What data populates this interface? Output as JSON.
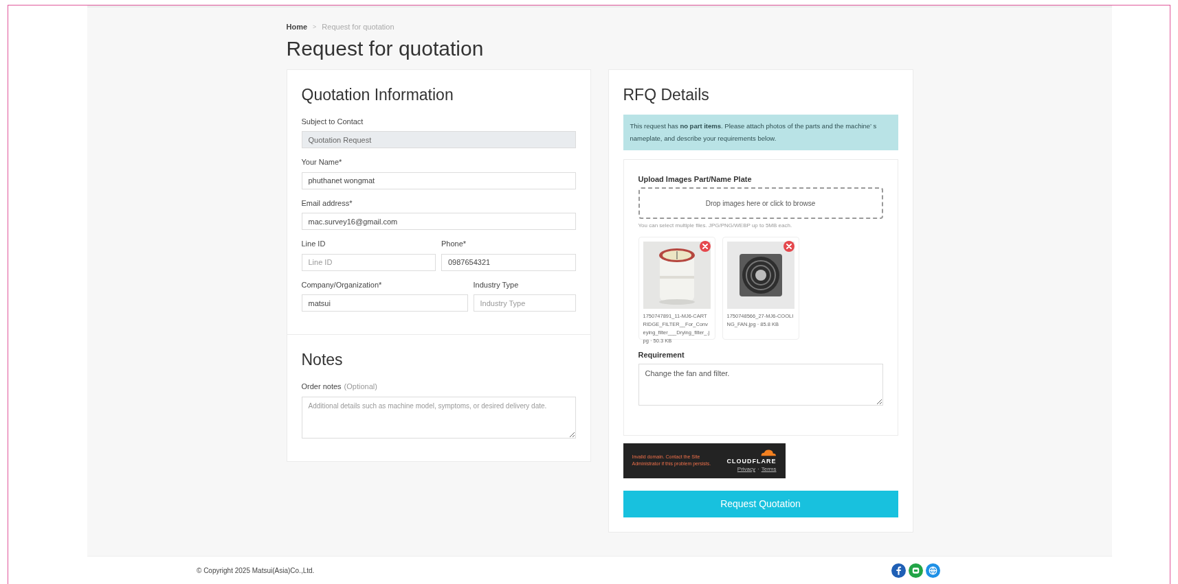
{
  "breadcrumb": {
    "items": [
      {
        "label": "Home",
        "current": false
      },
      {
        "label": "Request for quotation",
        "current": true
      }
    ],
    "separator": ">"
  },
  "title": "Request for quotation",
  "quotation_information": {
    "title": "Quotation Information",
    "rows": [
      {
        "kind": "single",
        "fields": [
          {
            "label": "Subject to Contact",
            "value": "Quotation Request",
            "disabled": true
          }
        ]
      },
      {
        "kind": "single",
        "fields": [
          {
            "label": "Your Name*",
            "value": "phuthanet wongmat",
            "disabled": false
          }
        ]
      },
      {
        "kind": "single",
        "fields": [
          {
            "label": "Email address*",
            "value": "mac.survey16@gmail.com",
            "disabled": false
          }
        ]
      },
      {
        "kind": "pair",
        "fields": [
          {
            "label": "Line ID",
            "placeholder": "Line ID",
            "disabled": false
          },
          {
            "label": "Phone*",
            "value": "0987654321",
            "disabled": false
          }
        ]
      },
      {
        "kind": "wide_narrow",
        "fields": [
          {
            "label": "Company/Organization*",
            "value": "matsui",
            "disabled": false
          },
          {
            "label": "Industry Type",
            "placeholder": "Industry Type",
            "disabled": false
          }
        ]
      }
    ]
  },
  "notes": {
    "title": "Notes",
    "label": "Order notes",
    "optional": "(Optional)",
    "placeholder": "Additional details such as machine model, symptoms, or desired delivery date."
  },
  "rfq_details": {
    "title": "RFQ Details",
    "alert": "This request has **no part items**. Please attach photos of the parts and the machine’ s nameplate, and describe your requirements below.",
    "upload": {
      "label": "Upload Images Part/Name Plate",
      "dropzone": "Drop images here or click to browse",
      "hint": "You can select multiple files. JPG/PNG/WEBP up to 5MB each.",
      "files": [
        {
          "kind": "picture",
          "caption": "1750747891_11-MJ6-CARTRIDGE_FILTER__For_Conveying_filter___Drying_filter_.jpg · 50.3 KB"
        },
        {
          "kind": "picture",
          "caption": "1750748566_27-MJ6-COOLING_FAN.jpg · 85.8 KB"
        }
      ]
    },
    "requirement": {
      "label": "Requirement",
      "value": "Change the fan and filter."
    },
    "captcha": {
      "message": "Invalid domain. Contact the Site Administrator if this problem persists.",
      "brand": "CLOUDFLARE",
      "links": [
        "Privacy",
        "Terms"
      ],
      "separator": "·"
    },
    "submit": "Request Quotation"
  },
  "footer": {
    "copyright": "© Copyright 2025 Matsui(Asia)Co.,Ltd."
  }
}
